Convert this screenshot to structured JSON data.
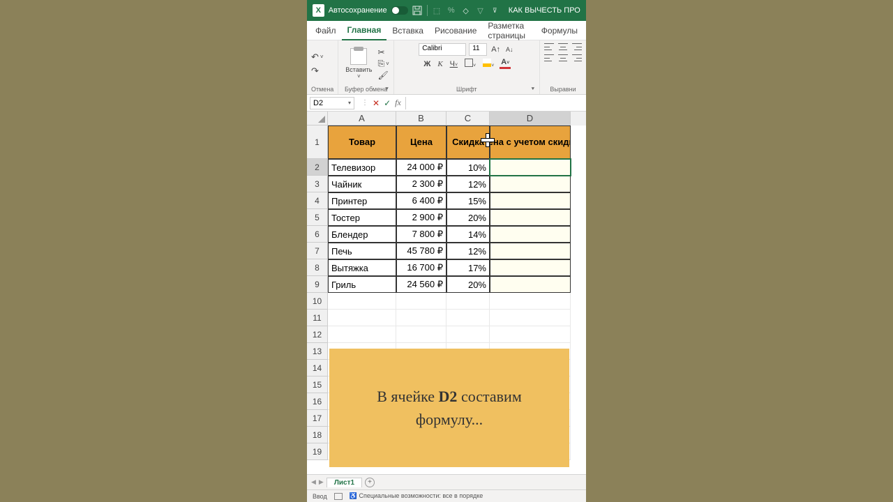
{
  "titlebar": {
    "autosave": "Автосохранение",
    "docTitle": "КАК ВЫЧЕСТЬ ПРОЦ"
  },
  "tabs": [
    "Файл",
    "Главная",
    "Вставка",
    "Рисование",
    "Разметка страницы",
    "Формулы"
  ],
  "activeTab": 1,
  "ribbon": {
    "undoGroup": "Отмена",
    "clipboardGroup": "Буфер обмена",
    "paste": "Вставить",
    "fontGroup": "Шрифт",
    "fontName": "Calibri",
    "fontSize": "11",
    "alignGroup": "Выравни"
  },
  "nameBox": "D2",
  "columns": [
    "A",
    "B",
    "C",
    "D"
  ],
  "headerRow": [
    "Товар",
    "Цена",
    "Скидка",
    "Цена с учетом скидки"
  ],
  "dataRows": [
    {
      "n": 2,
      "a": "Телевизор",
      "b": "24 000 ₽",
      "c": "10%"
    },
    {
      "n": 3,
      "a": "Чайник",
      "b": "2 300 ₽",
      "c": "12%"
    },
    {
      "n": 4,
      "a": "Принтер",
      "b": "6 400 ₽",
      "c": "15%"
    },
    {
      "n": 5,
      "a": "Тостер",
      "b": "2 900 ₽",
      "c": "20%"
    },
    {
      "n": 6,
      "a": "Блендер",
      "b": "7 800 ₽",
      "c": "14%"
    },
    {
      "n": 7,
      "a": "Печь",
      "b": "45 780 ₽",
      "c": "12%"
    },
    {
      "n": 8,
      "a": "Вытяжка",
      "b": "16 700 ₽",
      "c": "17%"
    },
    {
      "n": 9,
      "a": "Гриль",
      "b": "24 560 ₽",
      "c": "20%"
    }
  ],
  "emptyRows": [
    10,
    11,
    12,
    13,
    14,
    15,
    16,
    17,
    18,
    19
  ],
  "selectedCell": {
    "row": 2,
    "col": "D"
  },
  "note": {
    "pre": "В ячейке ",
    "strong": "D2",
    "post": " составим формулу..."
  },
  "sheetTab": "Лист1",
  "statusbar": {
    "mode": "Ввод",
    "access": "Специальные возможности: все в порядке"
  }
}
